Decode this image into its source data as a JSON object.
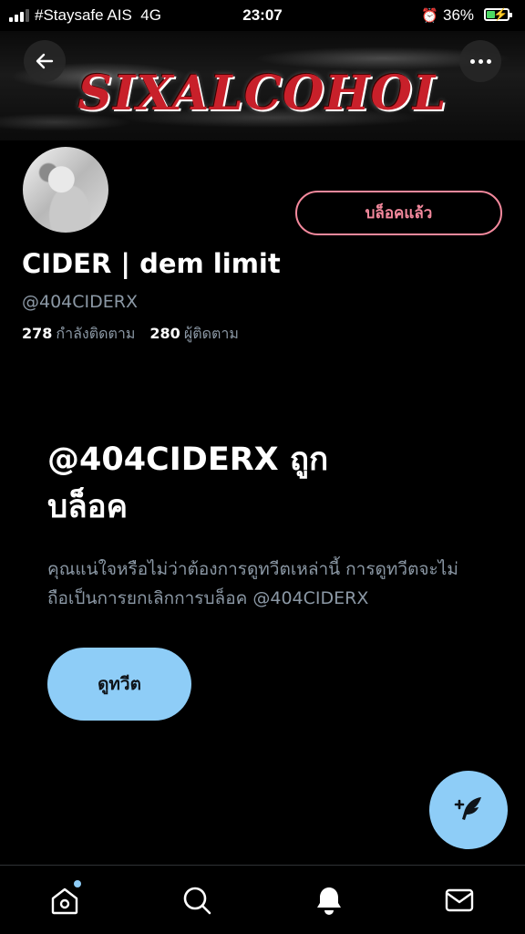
{
  "status_bar": {
    "carrier": "#Staysafe AIS",
    "network": "4G",
    "time": "23:07",
    "battery_percent": "36%",
    "battery_level": 0.36
  },
  "banner": {
    "logo_text": "SIXALCOHOL"
  },
  "profile": {
    "blocked_button_label": "บล็อคแล้ว",
    "display_name": "CIDER | dem limit",
    "handle": "@404CIDERX",
    "following_count": "278",
    "following_label": "กำลังติดตาม",
    "followers_count": "280",
    "followers_label": "ผู้ติดตาม"
  },
  "blocked_notice": {
    "title_line1": "@404CIDERX ถูก",
    "title_line2": "บล็อค",
    "description": "คุณแน่ใจหรือไม่ว่าต้องการดูทวีตเหล่านี้ การดูทวีตจะไม่ถือเป็นการยกเลิกการบล็อค @404CIDERX",
    "view_tweets_button": "ดูทวีต"
  },
  "icons": {
    "back": "arrow-left-icon",
    "more": "more-dots-icon",
    "compose": "compose-feather-icon",
    "home": "home-icon",
    "search": "search-icon",
    "notifications": "bell-icon",
    "messages": "mail-icon"
  },
  "colors": {
    "accent": "#8ecdf7",
    "blocked": "#f4899d",
    "secondary_text": "#8b98a5",
    "logo_red": "#c8202a"
  }
}
